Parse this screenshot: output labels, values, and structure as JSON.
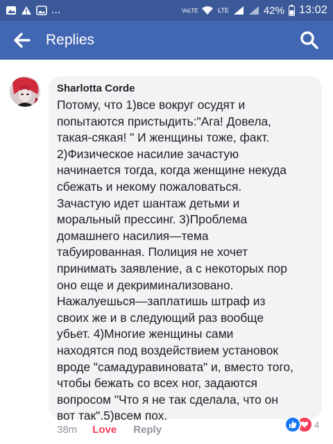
{
  "status_bar": {
    "left_icons": [
      "gallery-icon",
      "warning-icon",
      "image-icon",
      "more-notifications-icon"
    ],
    "more_text": "...",
    "volte": "VoLTE",
    "network": "LTE",
    "battery_percent": "42%",
    "time": "13:02"
  },
  "app_bar": {
    "title": "Replies",
    "back_icon": "arrow-back-icon",
    "search_icon": "search-icon",
    "background": "#4267b2"
  },
  "comment": {
    "author": "Sharlotta Corde",
    "text": "Потому, что 1)все вокруг осудят и\nпопытаются пристыдить:\"Ага! Довела,\nтакая-сякая! \" И женщины тоже, факт.\n2)Физическое насилие зачастую\nначинается тогда, когда женщине некуда\nсбежать и некому пожаловаться.\nЗачастую идет шантаж детьми и\nморальный прессинг. 3)Проблема\nдомашнего насилия—тема\nтабуированная. Полиция не хочет\nпринимать заявление, а с некоторых пор\nоно еще и декриминализовано.\nНажалуешься—заплатишь штраф из\nсвоих же и в следующий раз вообще\nубьет. 4)Многие женщины сами\nнаходятся под воздействием установок\nвроде \"самадуравиновата\" и, вместо того,\nчтобы бежать со всех ног, задаются\nвопросом \"Что я не так сделала, что он\nвот так\".5)всем пох.",
    "time_ago": "38m",
    "love_label": "Love",
    "reply_label": "Reply",
    "reaction_count": "4",
    "reaction_icons": [
      "like-icon",
      "love-icon"
    ],
    "love_color": "#f33e58"
  }
}
